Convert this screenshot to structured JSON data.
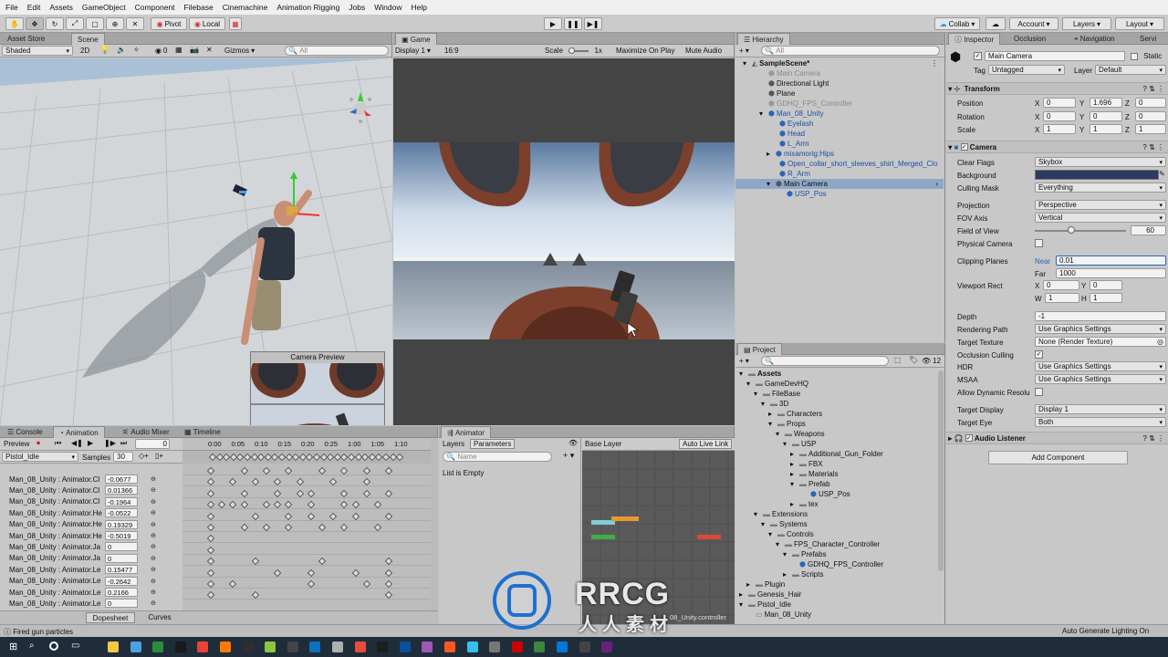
{
  "menu": [
    "File",
    "Edit",
    "Assets",
    "GameObject",
    "Component",
    "Filebase",
    "Cinemachine",
    "Animation Rigging",
    "Jobs",
    "Window",
    "Help"
  ],
  "toolbar": {
    "pivot": "Pivot",
    "local": "Local",
    "collab": "Collab",
    "account": "Account",
    "layers": "Layers",
    "layout": "Layout"
  },
  "scene": {
    "tabs": [
      "Asset Store",
      "Scene"
    ],
    "shading": "Shaded",
    "mode2d": "2D",
    "gizmos": "Gizmos",
    "search_placeholder": "All",
    "hidden_count": "0",
    "camera_preview_title": "Camera Preview"
  },
  "game": {
    "tab": "Game",
    "display": "Display 1",
    "aspect": "16:9",
    "scale_label": "Scale",
    "scale_value": "1x",
    "maximize": "Maximize On Play",
    "mute": "Mute Audio",
    "stats": "S"
  },
  "hierarchy": {
    "tab": "Hierarchy",
    "search_placeholder": "All",
    "items": [
      {
        "label": "SampleScene*",
        "style": "scene"
      },
      {
        "label": "Main Camera",
        "style": "disabled"
      },
      {
        "label": "Directional Light",
        "style": "normal"
      },
      {
        "label": "Plane",
        "style": "normal"
      },
      {
        "label": "GDHQ_FPS_Controller",
        "style": "disabled"
      },
      {
        "label": "Man_08_Unity",
        "style": "prefab"
      },
      {
        "label": "Eyelash",
        "style": "prefab"
      },
      {
        "label": "Head",
        "style": "prefab"
      },
      {
        "label": "L_Arm",
        "style": "prefab"
      },
      {
        "label": "mixamorig:Hips",
        "style": "prefab"
      },
      {
        "label": "Open_collar_short_sleeves_shirt_Merged_Clo",
        "style": "prefab"
      },
      {
        "label": "R_Arm",
        "style": "prefab"
      },
      {
        "label": "Main Camera",
        "style": "selected"
      },
      {
        "label": "USP_Pos",
        "style": "prefab"
      }
    ]
  },
  "project": {
    "tab": "Project",
    "count": "12",
    "items": [
      "Assets",
      "GameDevHQ",
      "FileBase",
      "3D",
      "Characters",
      "Props",
      "Weapons",
      "USP",
      "Additional_Gun_Folder",
      "FBX",
      "Materials",
      "Prefab",
      "USP_Pos",
      "tex",
      "Extensions",
      "Systems",
      "Controls",
      "FPS_Character_Controller",
      "Prefabs",
      "GDHQ_FPS_Controller",
      "Scripts",
      "Plugin",
      "Genesis_Hair",
      "Pistol_Idle",
      "Man_08_Unity"
    ],
    "footer": "08_Unity.controller"
  },
  "inspector": {
    "tabs": [
      "Inspector",
      "Occlusion",
      "Navigation",
      "Servi"
    ],
    "object_name": "Main Camera",
    "static": "Static",
    "tag_label": "Tag",
    "tag": "Untagged",
    "layer_label": "Layer",
    "layer": "Default",
    "transform": {
      "title": "Transform",
      "position": "Position",
      "rotation": "Rotation",
      "scale": "Scale",
      "pos": [
        "0",
        "1.696",
        "0"
      ],
      "rot": [
        "0",
        "0",
        "0"
      ],
      "scl": [
        "1",
        "1",
        "1"
      ]
    },
    "camera": {
      "title": "Camera",
      "clear_flags_label": "Clear Flags",
      "clear_flags": "Skybox",
      "background_label": "Background",
      "culling_mask_label": "Culling Mask",
      "culling_mask": "Everything",
      "projection_label": "Projection",
      "projection": "Perspective",
      "fov_axis_label": "FOV Axis",
      "fov_axis": "Vertical",
      "fov_label": "Field of View",
      "fov": "60",
      "physical_label": "Physical Camera",
      "clipping_label": "Clipping Planes",
      "near_label": "Near",
      "near": "0.01",
      "far_label": "Far",
      "far": "1000",
      "viewport_label": "Viewport Rect",
      "vx": "0",
      "vy": "0",
      "vw": "1",
      "vh": "1",
      "depth_label": "Depth",
      "depth": "-1",
      "rendering_path_label": "Rendering Path",
      "rendering_path": "Use Graphics Settings",
      "target_texture_label": "Target Texture",
      "target_texture": "None (Render Texture)",
      "occlusion_label": "Occlusion Culling",
      "hdr_label": "HDR",
      "hdr": "Use Graphics Settings",
      "msaa_label": "MSAA",
      "msaa": "Use Graphics Settings",
      "dynres_label": "Allow Dynamic Resolu",
      "target_display_label": "Target Display",
      "target_display": "Display 1",
      "target_eye_label": "Target Eye",
      "target_eye": "Both"
    },
    "audio_listener": "Audio Listener",
    "add_component": "Add Component"
  },
  "animation": {
    "tabs": [
      "Console",
      "Animation",
      "Audio Mixer",
      "Timeline"
    ],
    "preview": "Preview",
    "frame": "0",
    "clip": "Pistol_Idle",
    "samples_label": "Samples",
    "samples": "30",
    "timeline": [
      "0:00",
      "0:05",
      "0:10",
      "0:15",
      "0:20",
      "0:25",
      "1:00",
      "1:05",
      "1:10"
    ],
    "rows": [
      {
        "name": "Man_08_Unity : Animator.Cl",
        "value": "-0.0677"
      },
      {
        "name": "Man_08_Unity : Animator.Cl",
        "value": "0.01366"
      },
      {
        "name": "Man_08_Unity : Animator.Cl",
        "value": "-0.1964"
      },
      {
        "name": "Man_08_Unity : Animator.He",
        "value": "-0.0522"
      },
      {
        "name": "Man_08_Unity : Animator.He",
        "value": "0.19329"
      },
      {
        "name": "Man_08_Unity : Animator.He",
        "value": "-0.5019"
      },
      {
        "name": "Man_08_Unity : Animator.Ja",
        "value": "0"
      },
      {
        "name": "Man_08_Unity : Animator.Ja",
        "value": "0"
      },
      {
        "name": "Man_08_Unity : Animator.Le",
        "value": "0.15477"
      },
      {
        "name": "Man_08_Unity : Animator.Le",
        "value": "-0.2642"
      },
      {
        "name": "Man_08_Unity : Animator.Le",
        "value": "0.2166"
      },
      {
        "name": "Man_08_Unity : Animator.Le",
        "value": "0"
      }
    ],
    "dopesheet": "Dopesheet",
    "curves": "Curves"
  },
  "animator": {
    "tab": "Animator",
    "layers": "Layers",
    "parameters": "Parameters",
    "base_layer": "Base Layer",
    "auto_live": "Auto Live Link",
    "name_placeholder": "Name",
    "empty": "List is Empty"
  },
  "status": {
    "left": "Fired gun particles",
    "right": "Auto Generate Lighting On"
  },
  "watermark": {
    "line1": "RRCG",
    "line2": "人人素材"
  }
}
